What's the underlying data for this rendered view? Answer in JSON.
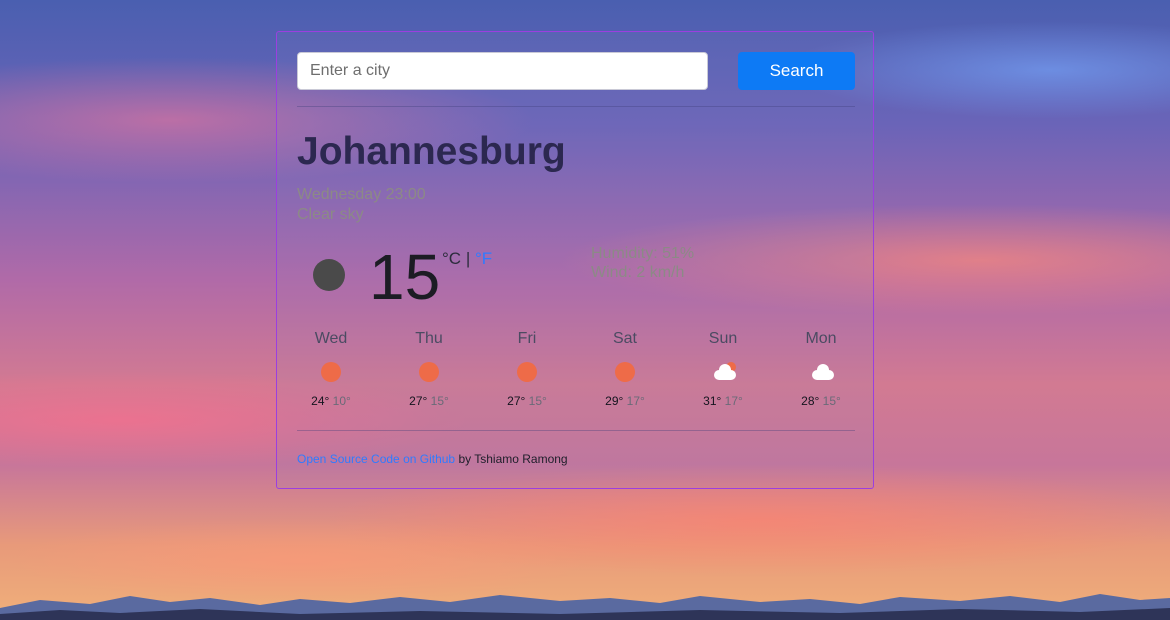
{
  "search": {
    "placeholder": "Enter a city",
    "button_label": "Search"
  },
  "current": {
    "city": "Johannesburg",
    "datetime": "Wednesday 23:00",
    "description": "Clear sky",
    "icon": "moon-dot-icon",
    "temperature": "15",
    "unit_celsius": "°C",
    "unit_separator": "|",
    "unit_fahrenheit": "°F",
    "humidity": "Humidity: 51%",
    "wind": "Wind: 2 km/h"
  },
  "forecast": [
    {
      "day": "Wed",
      "icon": "sun-icon",
      "max": "24°",
      "min": "10°"
    },
    {
      "day": "Thu",
      "icon": "sun-icon",
      "max": "27°",
      "min": "15°"
    },
    {
      "day": "Fri",
      "icon": "sun-icon",
      "max": "27°",
      "min": "15°"
    },
    {
      "day": "Sat",
      "icon": "sun-icon",
      "max": "29°",
      "min": "17°"
    },
    {
      "day": "Sun",
      "icon": "partly-cloudy-icon",
      "max": "31°",
      "min": "17°"
    },
    {
      "day": "Mon",
      "icon": "cloud-icon",
      "max": "28°",
      "min": "15°"
    }
  ],
  "footer": {
    "link_text": "Open Source Code on Github",
    "by_text": " by Tshiamo Ramong"
  },
  "colors": {
    "accent": "#0d7af5",
    "card_border": "#9b3fe0",
    "sun": "#ee6b48"
  }
}
